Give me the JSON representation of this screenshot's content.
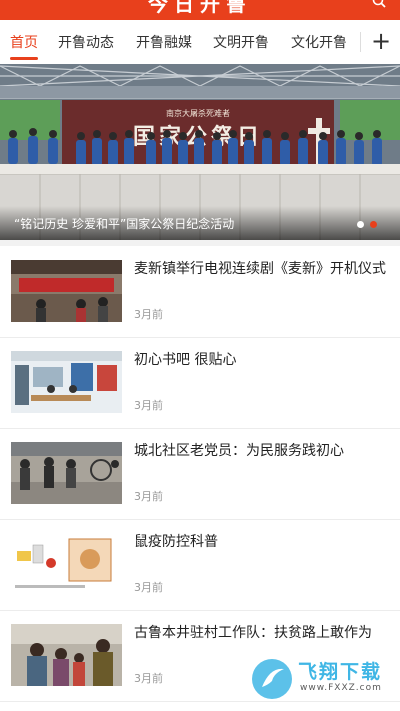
{
  "header": {
    "title": "今日开鲁",
    "search_icon": "search-icon",
    "bg_color": "#e8401c"
  },
  "tabs": [
    {
      "label": "首页",
      "active": true
    },
    {
      "label": "开鲁动态",
      "active": false
    },
    {
      "label": "开鲁融媒",
      "active": false
    },
    {
      "label": "文明开鲁",
      "active": false
    },
    {
      "label": "文化开鲁",
      "active": false
    }
  ],
  "tabs_add_icon": "plus-icon",
  "banner": {
    "caption": "“铭记历史 珍爱和平”国家公祭日纪念活动",
    "sign_small": "南京大屠杀死难者",
    "sign_large": "国家公祭日",
    "slides": 2,
    "active_slide": 2
  },
  "articles": [
    {
      "title": "麦新镇举行电视连续剧《麦新》开机仪式",
      "time": "3月前"
    },
    {
      "title": "初心书吧 很贴心",
      "time": "3月前"
    },
    {
      "title": "城北社区老党员：为民服务践初心",
      "time": "3月前"
    },
    {
      "title": "鼠疫防控科普",
      "time": "3月前"
    },
    {
      "title": "古鲁本井驻村工作队：扶贫路上敢作为",
      "time": "3月前"
    }
  ],
  "watermark": {
    "text": "飞翔下载",
    "url": "www.FXXZ.com"
  }
}
